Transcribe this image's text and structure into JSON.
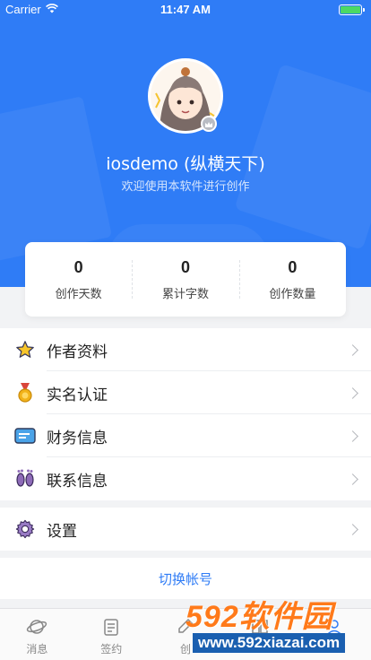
{
  "status_bar": {
    "carrier": "Carrier",
    "time": "11:47 AM"
  },
  "profile": {
    "username": "iosdemo (纵横天下)",
    "welcome": "欢迎使用本软件进行创作"
  },
  "stats": [
    {
      "value": "0",
      "label": "创作天数"
    },
    {
      "value": "0",
      "label": "累计字数"
    },
    {
      "value": "0",
      "label": "创作数量"
    }
  ],
  "menu": [
    {
      "label": "作者资料",
      "icon": "star-icon"
    },
    {
      "label": "实名认证",
      "icon": "medal-icon"
    },
    {
      "label": "财务信息",
      "icon": "wallet-icon"
    },
    {
      "label": "联系信息",
      "icon": "footprints-icon"
    }
  ],
  "settings": {
    "label": "设置",
    "icon": "gear-icon"
  },
  "switch_account": "切换帐号",
  "tabs": [
    {
      "label": "消息",
      "icon": "planet-icon"
    },
    {
      "label": "签约",
      "icon": "contract-icon"
    },
    {
      "label": "创",
      "icon": "write-icon"
    },
    {
      "label": "",
      "icon": "book-icon"
    },
    {
      "label": "",
      "icon": "user-icon"
    }
  ],
  "watermark": {
    "brand": "592软件园",
    "url": "www.592xiazai.com"
  },
  "colors": {
    "primary": "#2f7cf6",
    "accent_orange": "#ff7a1a"
  }
}
